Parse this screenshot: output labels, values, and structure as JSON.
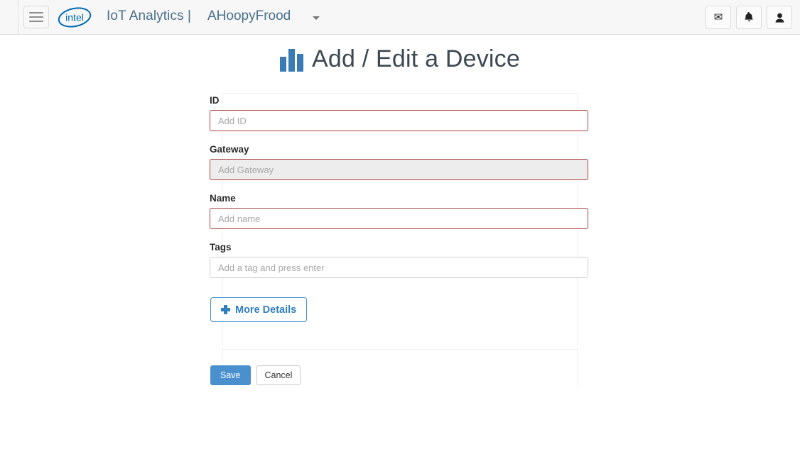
{
  "header": {
    "menu_icon": "hamburger-menu-icon",
    "logo": "intel-logo",
    "logo_text": "intel",
    "brand": "IoT Analytics |",
    "account": "AHoopyFrood",
    "caret_icon": "chevron-down-icon",
    "actions": [
      {
        "name": "messages-button",
        "icon": "envelope-icon",
        "glyph": "✉"
      },
      {
        "name": "notifications-button",
        "icon": "bell-icon",
        "glyph": "🔔"
      },
      {
        "name": "user-account-button",
        "icon": "user-icon",
        "glyph": "👤"
      }
    ]
  },
  "page": {
    "title": "Add / Edit a Device",
    "title_icon": "bar-chart-icon"
  },
  "form": {
    "fields": [
      {
        "name": "id",
        "label": "ID",
        "placeholder": "Add ID",
        "value": "",
        "state": "required-empty",
        "disabled": false
      },
      {
        "name": "gateway",
        "label": "Gateway",
        "placeholder": "Add Gateway",
        "value": "",
        "state": "required-empty",
        "disabled": true
      },
      {
        "name": "device-name",
        "label": "Name",
        "placeholder": "Add name",
        "value": "",
        "state": "required-empty",
        "disabled": false
      },
      {
        "name": "tags",
        "label": "Tags",
        "placeholder": "Add a tag and press enter",
        "value": "",
        "state": "optional",
        "disabled": false
      }
    ],
    "more_details_label": "More Details",
    "more_details_icon": "plus-icon",
    "save_label": "Save",
    "cancel_label": "Cancel"
  },
  "colors": {
    "brand_blue": "#3b7bb5",
    "header_bg": "#f7f7f7",
    "error_border": "#a94442",
    "link_blue": "#3380c0",
    "save_bg": "#4a90cf",
    "title_text": "#3d4852"
  }
}
